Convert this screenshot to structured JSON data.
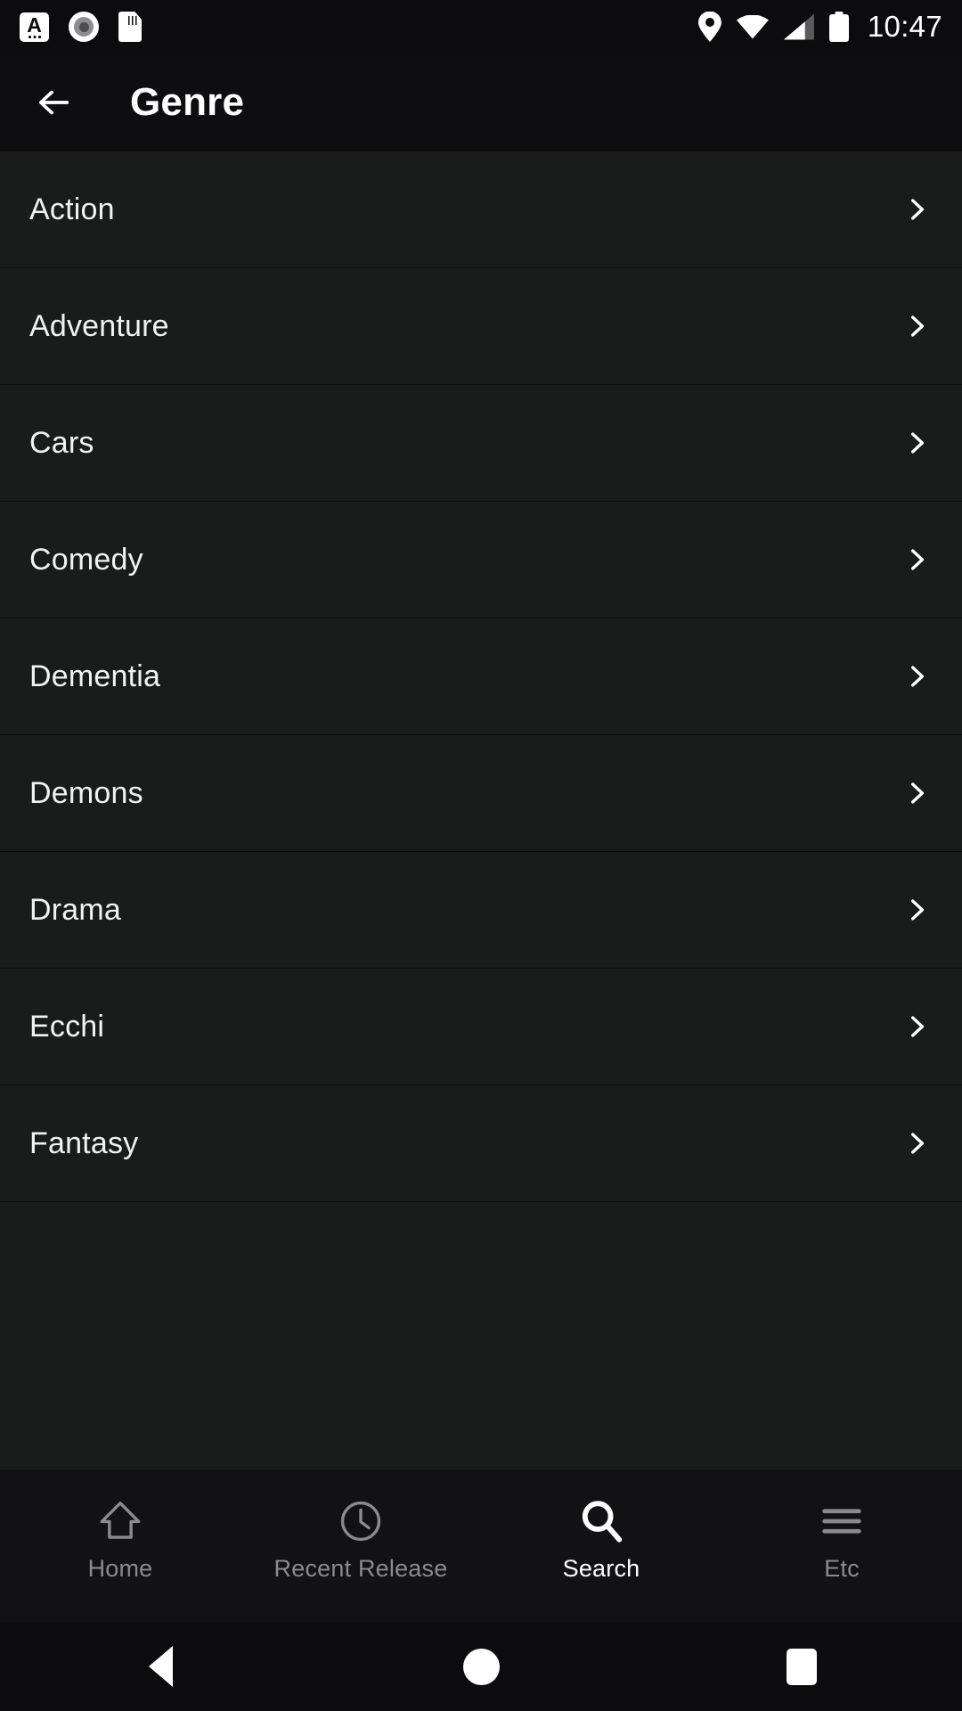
{
  "status_bar": {
    "icons_left": [
      {
        "name": "input-method-icon",
        "glyph": "A"
      },
      {
        "name": "screen-record-icon",
        "glyph": "record"
      },
      {
        "name": "sd-card-icon",
        "glyph": "sd"
      }
    ],
    "icons_right": [
      {
        "name": "location-icon",
        "glyph": "pin"
      },
      {
        "name": "wifi-icon",
        "glyph": "wifi-full"
      },
      {
        "name": "cell-signal-icon",
        "glyph": "signal-partial"
      },
      {
        "name": "battery-icon",
        "glyph": "battery-full"
      }
    ],
    "clock": "10:47"
  },
  "header": {
    "title": "Genre",
    "back_icon": "arrow-left-icon"
  },
  "genre_list": {
    "row_chevron_icon": "chevron-right-icon",
    "items": [
      {
        "label": "Action"
      },
      {
        "label": "Adventure"
      },
      {
        "label": "Cars"
      },
      {
        "label": "Comedy"
      },
      {
        "label": "Dementia"
      },
      {
        "label": "Demons"
      },
      {
        "label": "Drama"
      },
      {
        "label": "Ecchi"
      },
      {
        "label": "Fantasy"
      }
    ]
  },
  "bottom_nav": {
    "items": [
      {
        "label": "Home",
        "icon": "home-icon",
        "active": false
      },
      {
        "label": "Recent Release",
        "icon": "clock-icon",
        "active": false
      },
      {
        "label": "Search",
        "icon": "search-icon",
        "active": true
      },
      {
        "label": "Etc",
        "icon": "hamburger-menu-icon",
        "active": false
      }
    ]
  },
  "android_nav": {
    "back": "back-triangle-icon",
    "home": "home-circle-icon",
    "recents": "recents-square-icon"
  },
  "colors": {
    "header_bg": "#0e0e10",
    "row_bg": "#1a1c1c",
    "nav_bg": "#121214",
    "text_primary": "#f2f2f2",
    "text_inactive": "#8b8b8e",
    "accent_active": "#ffffff"
  }
}
